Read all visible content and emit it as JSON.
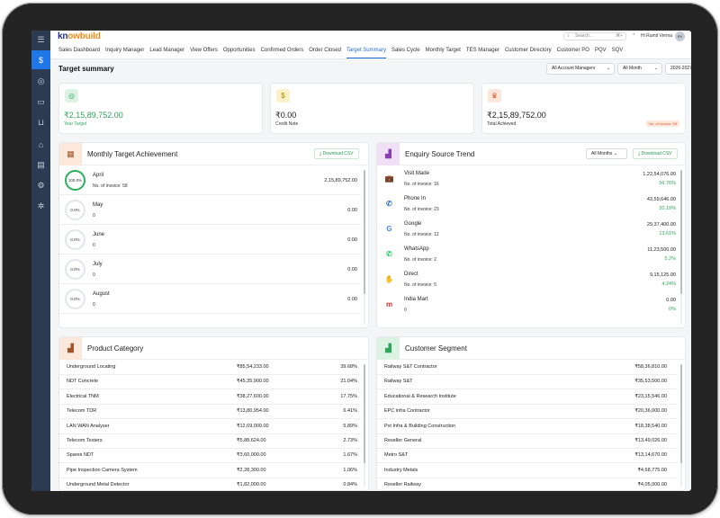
{
  "brand": {
    "logo_main": "kn",
    "logo_rest": "owbuild"
  },
  "topbar": {
    "search_placeholder": "Search...",
    "search_shortcut": "⌘+",
    "greeting": "Hi Rumit Verma",
    "avatar_initials": "RV"
  },
  "nav": {
    "tabs": [
      "Sales Dashboard",
      "Inquiry Manager",
      "Lead Manager",
      "View Offers",
      "Opportunities",
      "Confirmed Orders",
      "Order Closed",
      "Target Summary",
      "Sales Cycle",
      "Monthly Target",
      "TES Manager",
      "Customer Directory",
      "Customer PO",
      "PQV",
      "SQV"
    ],
    "active": "Target Summary"
  },
  "page": {
    "title": "Target summary"
  },
  "filters": {
    "manager": "All Account Managers",
    "month": "All Month",
    "year": "2026-2027"
  },
  "kpis": {
    "year_target": {
      "value": "₹2,15,89,752.00",
      "label": "Year Target"
    },
    "credit_note": {
      "value": "₹0.00",
      "label": "Credit Note"
    },
    "total_achieved": {
      "value": "₹2,15,89,752.00",
      "label": "Total Achieved",
      "badge": "No. of invoice: 58"
    }
  },
  "monthly": {
    "title": "Monthly Target Achievement",
    "csv": "Download CSV",
    "rows": [
      {
        "pct": "100.0%",
        "month": "April",
        "invoice": "No. of invoice: 58",
        "amount": "2,15,89,752.00",
        "progress": 1.0
      },
      {
        "pct": "0.0%",
        "month": "May",
        "invoice": "0",
        "amount": "0.00",
        "progress": 0
      },
      {
        "pct": "0.0%",
        "month": "June",
        "invoice": "0",
        "amount": "0.00",
        "progress": 0
      },
      {
        "pct": "0.0%",
        "month": "July",
        "invoice": "0",
        "amount": "0.00",
        "progress": 0
      },
      {
        "pct": "0.0%",
        "month": "August",
        "invoice": "0",
        "amount": "0.00",
        "progress": 0
      }
    ]
  },
  "enquiry": {
    "title": "Enquiry Source Trend",
    "select": "All Months",
    "csv": "Download CSV",
    "rows": [
      {
        "icon": "briefcase-icon",
        "name": "Visit Made",
        "invoice": "No. of invoice: 16",
        "amount": "1,22,54,076.00",
        "pct": "56.76%"
      },
      {
        "icon": "phone-icon",
        "name": "Phone In",
        "invoice": "No. of invoice: 23",
        "amount": "43,59,646.00",
        "pct": "20.19%"
      },
      {
        "icon": "google-icon",
        "name": "Google",
        "invoice": "No. of invoice: 12",
        "amount": "29,37,400.00",
        "pct": "13.61%"
      },
      {
        "icon": "whatsapp-icon",
        "name": "WhatsApp",
        "invoice": "No. of invoice: 2",
        "amount": "11,23,500.00",
        "pct": "5.2%"
      },
      {
        "icon": "handshake-icon",
        "name": "Direct",
        "invoice": "No. of invoice: 5",
        "amount": "9,15,125.00",
        "pct": "4.24%"
      },
      {
        "icon": "indiamart-icon",
        "name": "India Mart",
        "invoice": "0",
        "amount": "0.00",
        "pct": "0%"
      }
    ]
  },
  "product": {
    "title": "Product Category",
    "rows": [
      {
        "name": "Underground Locating",
        "amount": "₹85,54,233.00",
        "pct": "39.68%"
      },
      {
        "name": "NDT Concrete",
        "amount": "₹45,35,900.00",
        "pct": "21.04%"
      },
      {
        "name": "Electrical TNM",
        "amount": "₹38,27,600.00",
        "pct": "17.75%"
      },
      {
        "name": "Telecom TDR",
        "amount": "₹13,80,954.00",
        "pct": "6.41%"
      },
      {
        "name": "LAN WAN Analyser",
        "amount": "₹12,69,000.00",
        "pct": "5.89%"
      },
      {
        "name": "Telecom Testers",
        "amount": "₹5,88,624.00",
        "pct": "2.73%"
      },
      {
        "name": "Spares NDT",
        "amount": "₹3,60,000.00",
        "pct": "1.67%"
      },
      {
        "name": "Pipe Inspection Camera System",
        "amount": "₹2,28,300.00",
        "pct": "1.06%"
      },
      {
        "name": "Underground Metal Detector",
        "amount": "₹1,82,000.00",
        "pct": "0.84%"
      }
    ]
  },
  "segment": {
    "title": "Customer Segment",
    "rows": [
      {
        "name": "Railway S&T Contractor",
        "amount": "₹58,36,810.00"
      },
      {
        "name": "Railway S&T",
        "amount": "₹35,53,500.00"
      },
      {
        "name": "Educational & Research Institute",
        "amount": "₹23,15,546.00"
      },
      {
        "name": "EPC infra Contractor",
        "amount": "₹20,36,000.00"
      },
      {
        "name": "Pvt Infra & Building Construction",
        "amount": "₹18,38,540.00"
      },
      {
        "name": "Reseller General",
        "amount": "₹13,49,026.00"
      },
      {
        "name": "Metro S&T",
        "amount": "₹13,14,670.00"
      },
      {
        "name": "Industry Metals",
        "amount": "₹4,68,775.00"
      },
      {
        "name": "Reseller Railway",
        "amount": "₹4,05,000.00"
      }
    ]
  },
  "colors": {
    "accent": "#1f6fd6",
    "green": "#2fa55a",
    "rail": "#2c3b52"
  }
}
